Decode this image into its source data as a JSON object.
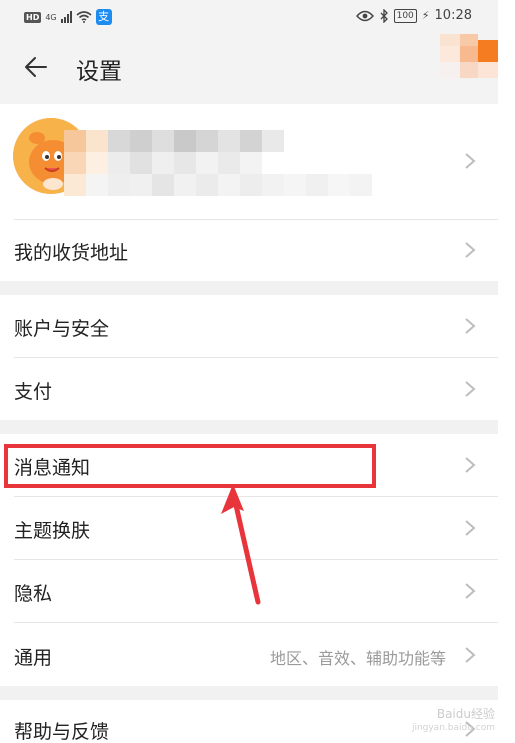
{
  "statusbar": {
    "network_label": "HD",
    "network_type": "4G",
    "alipay_icon_char": "支",
    "battery": "100",
    "time": "10:28"
  },
  "header": {
    "title": "设置",
    "back_icon": "arrow-left-icon"
  },
  "sections": [
    {
      "items": [
        {
          "id": "address",
          "label": "我的收货地址"
        }
      ]
    },
    {
      "items": [
        {
          "id": "account-security",
          "label": "账户与安全"
        },
        {
          "id": "payment",
          "label": "支付"
        }
      ]
    },
    {
      "items": [
        {
          "id": "notifications",
          "label": "消息通知"
        },
        {
          "id": "theme",
          "label": "主题换肤"
        },
        {
          "id": "privacy",
          "label": "隐私"
        },
        {
          "id": "general",
          "label": "通用",
          "hint": "地区、音效、辅助功能等"
        }
      ]
    },
    {
      "items": [
        {
          "id": "help-feedback",
          "label": "帮助与反馈"
        }
      ]
    }
  ],
  "annotation": {
    "highlight_color": "#e8353b",
    "highlighted_item": "消息通知"
  },
  "watermark": {
    "line1": "Baidu经验",
    "line2": "jingyan.baidu.com"
  },
  "colors": {
    "page_background": "#f1f1f1",
    "card_background": "#ffffff",
    "accent_orange": "#f57c20",
    "chevron": "#bdbdbd"
  }
}
